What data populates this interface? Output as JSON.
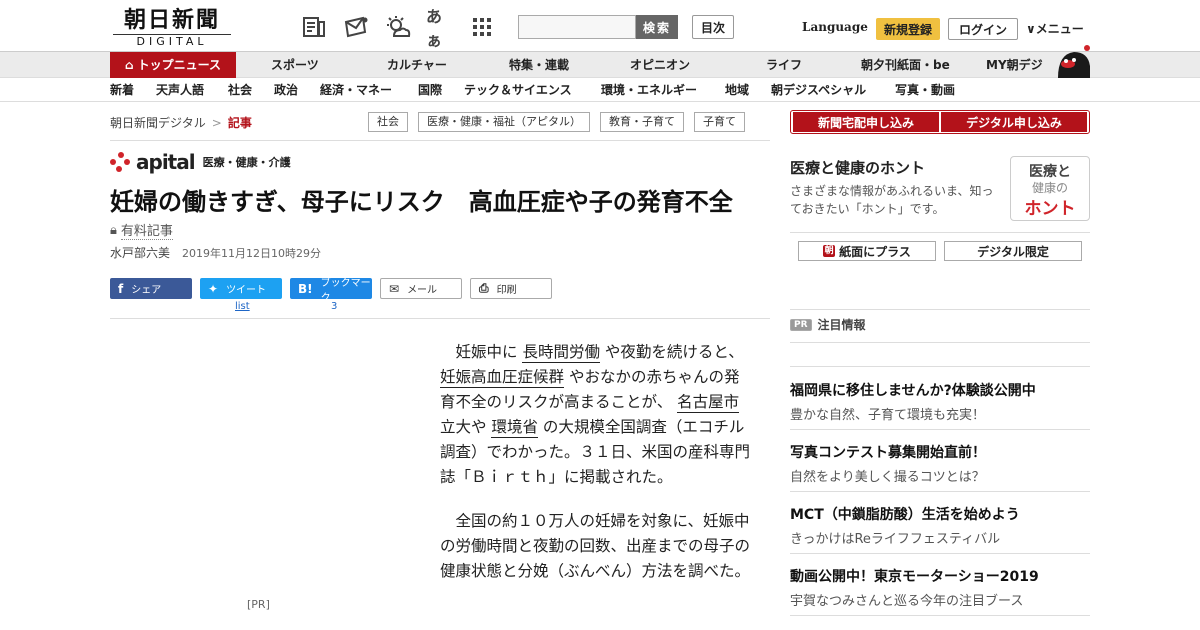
{
  "header": {
    "logo_jp": "朝日新聞",
    "logo_en": "DIGITAL",
    "search_button": "検索",
    "mokuji_button": "目次",
    "language_link": "Language",
    "register_button": "新規登録",
    "login_button": "ログイン",
    "menu_button": "∨メニュー",
    "icon_labels": {
      "aa": "あぁ"
    }
  },
  "nav_main": {
    "top_news": "トップニュース",
    "items": [
      "スポーツ",
      "カルチャー",
      "特集・連載",
      "オピニオン",
      "ライフ",
      "朝夕刊紙面・be",
      "MY朝デジ"
    ]
  },
  "nav_sub": {
    "items": [
      "新着",
      "天声人語",
      "社会",
      "政治",
      "経済・マネー",
      "国際",
      "テック＆サイエンス",
      "環境・エネルギー",
      "地域",
      "朝デジスペシャル",
      "写真・動画"
    ]
  },
  "breadcrumb": {
    "root": "朝日新聞デジタル",
    "separator": ">",
    "current": "記事"
  },
  "tags": [
    "社会",
    "医療・健康・福祉（アピタル）",
    "教育・子育て",
    "子育て"
  ],
  "apital": {
    "brand": "apital",
    "subtitle": "医療・健康・介護"
  },
  "article": {
    "title": "妊婦の働きすぎ、母子にリスク　高血圧症や子の発育不全",
    "paid_label": "有料記事",
    "author": "水戸部六美",
    "date": "2019年11月12日10時29分",
    "pr_label": "[PR]",
    "para1": {
      "t1": "妊娠中に",
      "k1": "長時間労働",
      "t2": "や夜勤を続けると、",
      "k2": "妊娠高血圧症候群",
      "t3": "やおなかの赤ちゃんの発育不全のリスクが高まることが、",
      "k3": "名古屋市",
      "t4": "立大や",
      "k4": "環境省",
      "t5": "の大規模全国調査（エコチル調査）でわかった。３１日、米国の産科専門誌「Ｂｉｒｔｈ」に掲載された。"
    },
    "para2": "全国の約１０万人の妊婦を対象に、妊娠中の労働時間と夜勤の回数、出産までの母子の健康状態と分娩（ぶんべん）方法を調べた。"
  },
  "share": {
    "facebook": "シェア",
    "twitter": "ツイート",
    "hatena": "ブックマーク",
    "mail": "メール",
    "print": "印刷",
    "twitter_count": "list",
    "hatena_count": "3",
    "hatena_mark": "B!"
  },
  "sidebar": {
    "subscribe_home": "新聞宅配申し込み",
    "subscribe_digital": "デジタル申し込み",
    "honto_title": "医療と健康のホント",
    "honto_desc": "さまざまな情報があふれるいま、知っておきたい「ホント」です。",
    "honto_box": {
      "line1": "医療と",
      "line2": "健康の",
      "line3": "ホント"
    },
    "shimen_plus": "紙面にプラス",
    "shimen_mark": "朝",
    "digital_limited": "デジタル限定",
    "pr_badge": "PR",
    "pr_heading": "注目情報",
    "ads": [
      {
        "title": "福岡県に移住しませんか?体験談公開中",
        "desc": "豊かな自然、子育て環境も充実！"
      },
      {
        "title": "写真コンテスト募集開始直前！",
        "desc": "自然をより美しく撮るコツとは？"
      },
      {
        "title": "MCT（中鎖脂肪酸）生活を始めよう",
        "desc": "きっかけはReライフフェスティバル"
      },
      {
        "title": "動画公開中！東京モーターショー2019",
        "desc": "宇賀なつみさんと巡る今年の注目ブース"
      }
    ]
  }
}
